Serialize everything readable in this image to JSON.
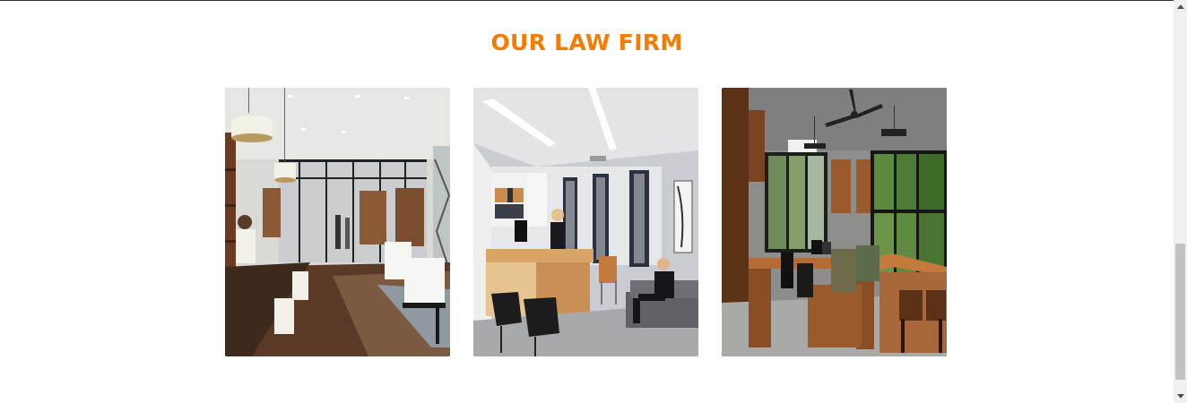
{
  "section": {
    "title": "OUR LAW FIRM",
    "title_color": "#f57c00"
  },
  "gallery": {
    "photos": [
      {
        "icon": "office-photo-open-plan"
      },
      {
        "icon": "office-photo-private-office"
      },
      {
        "icon": "office-photo-workspace"
      }
    ]
  },
  "scrollbar": {
    "position_fraction": 0.65
  }
}
